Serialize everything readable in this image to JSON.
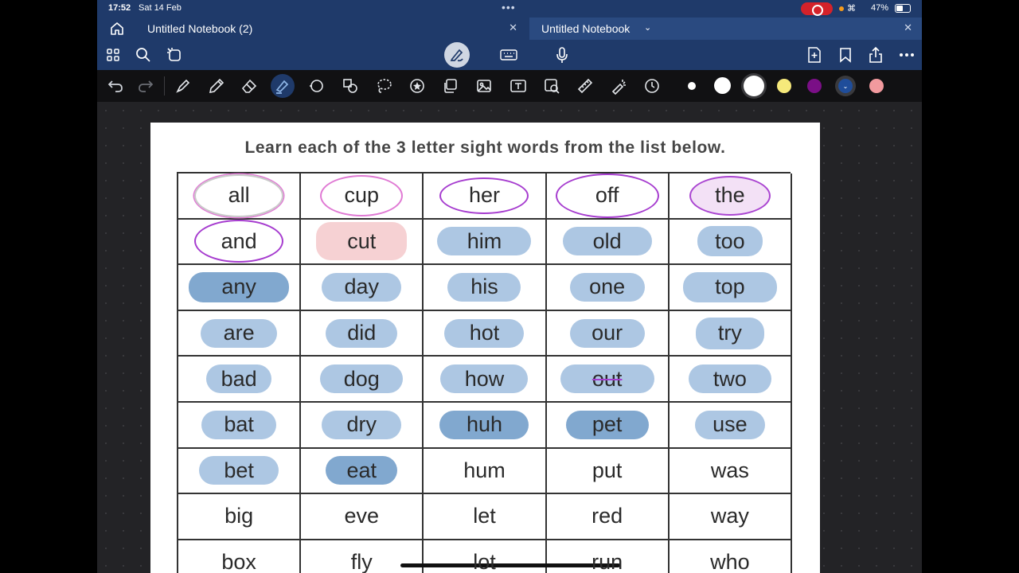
{
  "status_bar": {
    "time": "17:52",
    "date": "Sat 14 Feb",
    "battery": "47%"
  },
  "tabs": [
    {
      "label": "Untitled Notebook (2)",
      "active": false
    },
    {
      "label": "Untitled Notebook",
      "active": true
    }
  ],
  "icons": {
    "home": "home-icon",
    "grid": "grid-icon",
    "search": "search-icon",
    "lasso_mode": "lasso-mode-icon",
    "pen_mode": "pen-mode-icon",
    "keyboard": "keyboard-icon",
    "microphone": "microphone-icon",
    "add_page": "add-page-icon",
    "bookmark": "bookmark-icon",
    "share": "share-icon",
    "more": "more-icon"
  },
  "tools": [
    "undo",
    "redo",
    "pen",
    "pencil",
    "eraser",
    "highlighter",
    "shape",
    "shapes-lasso",
    "lasso",
    "sticker",
    "element",
    "image",
    "text",
    "image-search",
    "ruler",
    "laser-pointer",
    "timer"
  ],
  "colors": {
    "chrome_blue": "#1f3a6a",
    "swatches": [
      "#ffffff",
      "#ffffff",
      "#ffffff",
      "#f6e97b",
      "#7a0f86",
      "#1f3a6a",
      "#f29a9e"
    ],
    "highlight_light": "#a9c4e2",
    "highlight_dark": "#7aa3cc",
    "circle_purple": "#a63ccf",
    "circle_pink": "#e07ad4"
  },
  "worksheet": {
    "instruction": "Learn each of the 3 letter sight words from the list below.",
    "rows": [
      [
        "all",
        "cup",
        "her",
        "off",
        "the"
      ],
      [
        "and",
        "cut",
        "him",
        "old",
        "too"
      ],
      [
        "any",
        "day",
        "his",
        "one",
        "top"
      ],
      [
        "are",
        "did",
        "hot",
        "our",
        "try"
      ],
      [
        "bad",
        "dog",
        "how",
        "out",
        "two"
      ],
      [
        "bat",
        "dry",
        "huh",
        "pet",
        "use"
      ],
      [
        "bet",
        "eat",
        "hum",
        "put",
        "was"
      ],
      [
        "big",
        "eve",
        "let",
        "red",
        "way"
      ],
      [
        "box",
        "fly",
        "lot",
        "run",
        "who"
      ]
    ]
  }
}
